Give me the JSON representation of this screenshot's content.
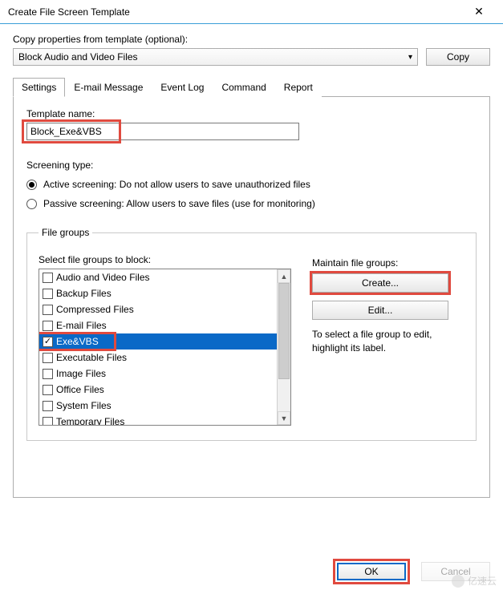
{
  "window": {
    "title": "Create File Screen Template",
    "close_glyph": "✕"
  },
  "copy_section": {
    "label": "Copy properties from template (optional):",
    "selected": "Block Audio and Video Files",
    "copy_button": "Copy"
  },
  "tabs": {
    "items": [
      "Settings",
      "E-mail Message",
      "Event Log",
      "Command",
      "Report"
    ],
    "active_index": 0
  },
  "settings": {
    "template_name_label": "Template name:",
    "template_name_value": "Block_Exe&VBS",
    "screening_label": "Screening type:",
    "radios": [
      {
        "label": "Active screening: Do not allow users to save unauthorized files",
        "checked": true
      },
      {
        "label": "Passive screening: Allow users to save files (use for monitoring)",
        "checked": false
      }
    ],
    "file_groups": {
      "legend": "File groups",
      "select_label": "Select file groups to block:",
      "items": [
        {
          "label": "Audio and Video Files",
          "checked": false,
          "selected": false
        },
        {
          "label": "Backup Files",
          "checked": false,
          "selected": false
        },
        {
          "label": "Compressed Files",
          "checked": false,
          "selected": false
        },
        {
          "label": "E-mail Files",
          "checked": false,
          "selected": false
        },
        {
          "label": "Exe&VBS",
          "checked": true,
          "selected": true
        },
        {
          "label": "Executable Files",
          "checked": false,
          "selected": false
        },
        {
          "label": "Image Files",
          "checked": false,
          "selected": false
        },
        {
          "label": "Office Files",
          "checked": false,
          "selected": false
        },
        {
          "label": "System Files",
          "checked": false,
          "selected": false
        },
        {
          "label": "Temporary Files",
          "checked": false,
          "selected": false
        }
      ],
      "maintain_label": "Maintain file groups:",
      "create_button": "Create...",
      "edit_button": "Edit...",
      "hint": "To select a file group to edit, highlight its label."
    }
  },
  "footer": {
    "ok": "OK",
    "cancel": "Cancel"
  },
  "watermark": "亿速云"
}
